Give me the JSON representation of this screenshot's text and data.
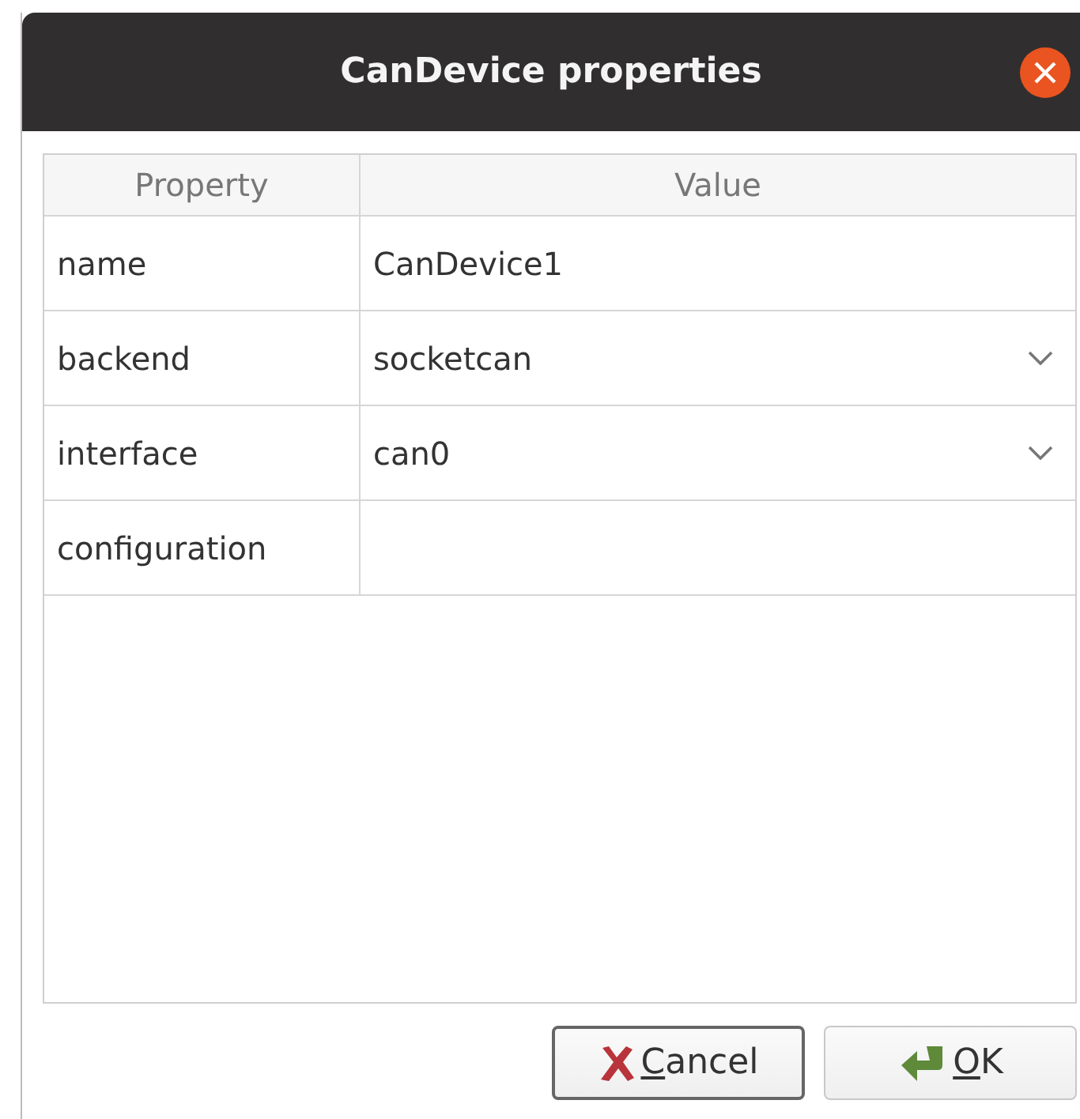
{
  "window": {
    "title": "CanDevice properties"
  },
  "table": {
    "columns": [
      "Property",
      "Value"
    ],
    "rows": [
      {
        "property": "name",
        "value": "CanDevice1",
        "kind": "text"
      },
      {
        "property": "backend",
        "value": "socketcan",
        "kind": "dropdown"
      },
      {
        "property": "interface",
        "value": "can0",
        "kind": "dropdown"
      },
      {
        "property": "configuration",
        "kind": "text"
      }
    ]
  },
  "buttons": [
    {
      "mnemonic": "C",
      "rest": "ancel",
      "kind": "cancel",
      "focused": true
    },
    {
      "mnemonic": "O",
      "rest": "K",
      "kind": "ok",
      "focused": false
    }
  ]
}
